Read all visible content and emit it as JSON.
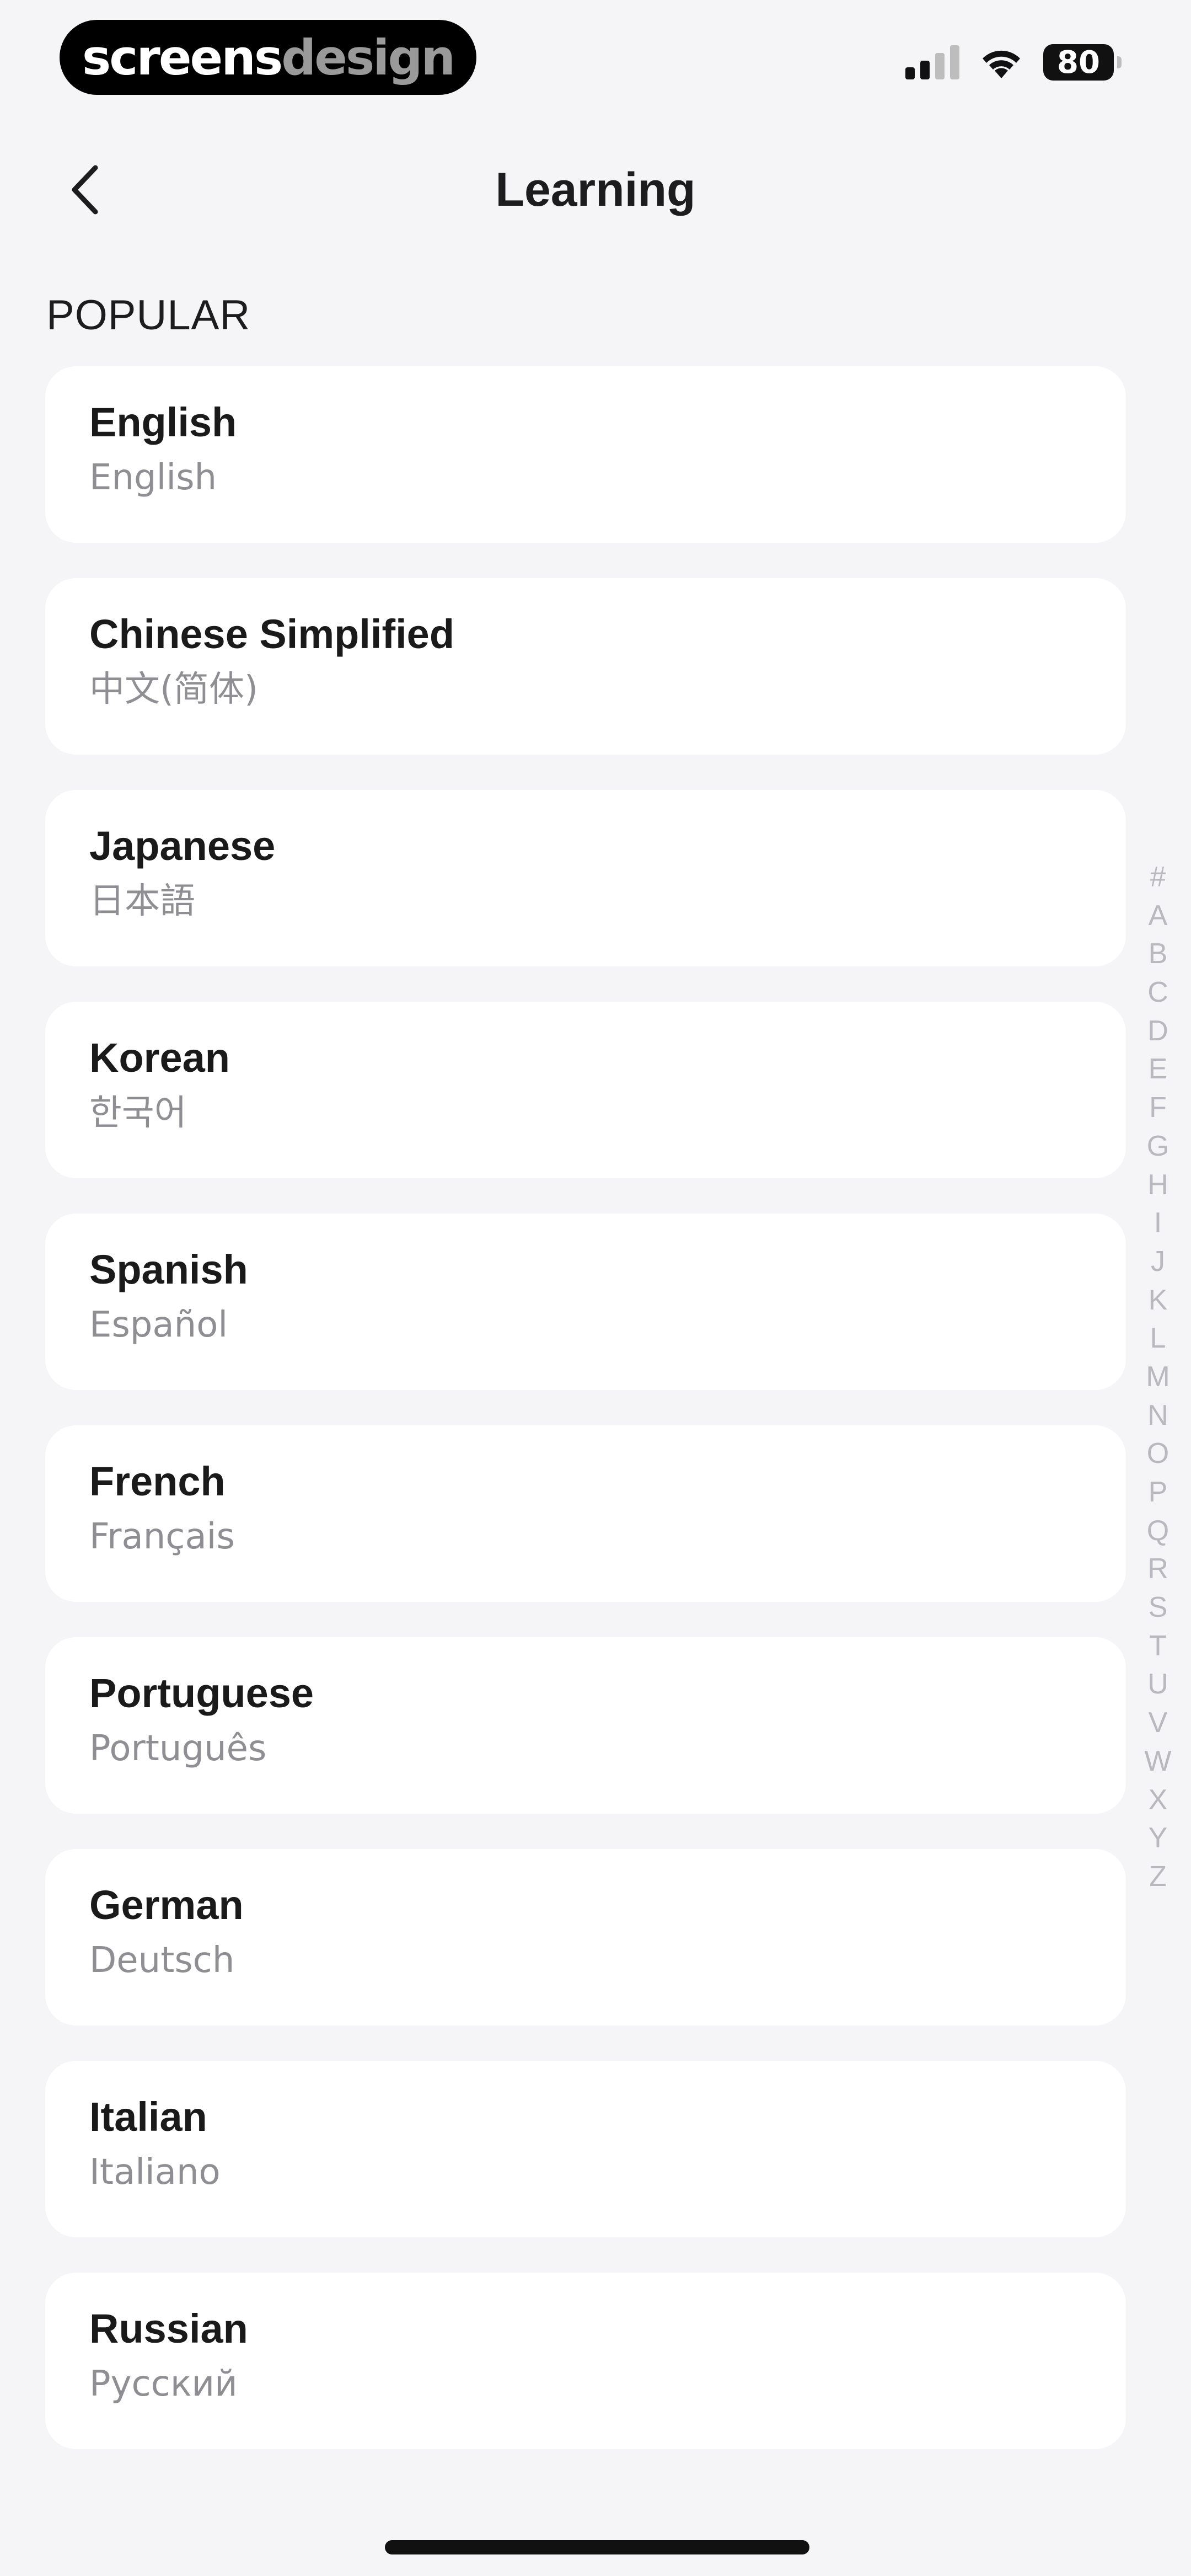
{
  "status_bar": {
    "brand_part1": "screens",
    "brand_part2": "design",
    "battery": "80"
  },
  "header": {
    "title": "Learning",
    "back_icon": "chevron-left-icon"
  },
  "section": {
    "label": "POPULAR"
  },
  "languages": [
    {
      "name": "English",
      "native": "English"
    },
    {
      "name": "Chinese Simplified",
      "native": "中文(简体)"
    },
    {
      "name": "Japanese",
      "native": "日本語"
    },
    {
      "name": "Korean",
      "native": "한국어"
    },
    {
      "name": "Spanish",
      "native": "Español"
    },
    {
      "name": "French",
      "native": "Français"
    },
    {
      "name": "Portuguese",
      "native": "Português"
    },
    {
      "name": "German",
      "native": "Deutsch"
    },
    {
      "name": "Italian",
      "native": "Italiano"
    },
    {
      "name": "Russian",
      "native": "Русский"
    }
  ],
  "alpha_index": [
    "#",
    "A",
    "B",
    "C",
    "D",
    "E",
    "F",
    "G",
    "H",
    "I",
    "J",
    "K",
    "L",
    "M",
    "N",
    "O",
    "P",
    "Q",
    "R",
    "S",
    "T",
    "U",
    "V",
    "W",
    "X",
    "Y",
    "Z"
  ],
  "colors": {
    "background": "#f5f5f8",
    "card": "#ffffff",
    "secondary_text": "#8e8e93",
    "index_text": "#b8b8be"
  }
}
